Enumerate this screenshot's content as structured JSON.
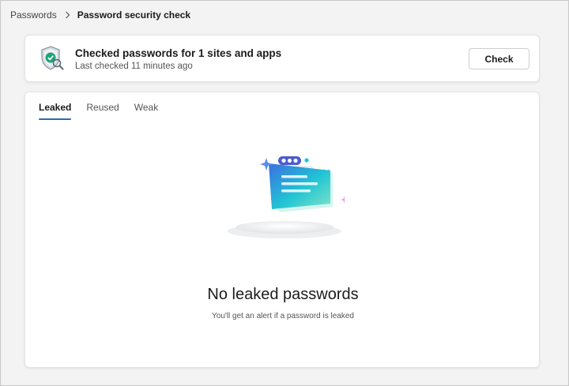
{
  "breadcrumb": {
    "parent": "Passwords",
    "current": "Password security check"
  },
  "summary": {
    "title": "Checked passwords for 1 sites and apps",
    "subtitle": "Last checked 11 minutes ago",
    "check_button": "Check"
  },
  "tabs": [
    {
      "label": "Leaked",
      "active": true
    },
    {
      "label": "Reused",
      "active": false
    },
    {
      "label": "Weak",
      "active": false
    }
  ],
  "empty_state": {
    "title": "No leaked passwords",
    "subtitle": "You'll get an alert if a password is leaked"
  },
  "colors": {
    "accent": "#2b6cb0",
    "shield_check": "#1fa37a",
    "illustration_teal": "#21c4d4",
    "illustration_blue": "#3b6fe0"
  },
  "icons": {
    "breadcrumb_separator": "chevron-right-icon",
    "summary": "shield-check-icon"
  }
}
